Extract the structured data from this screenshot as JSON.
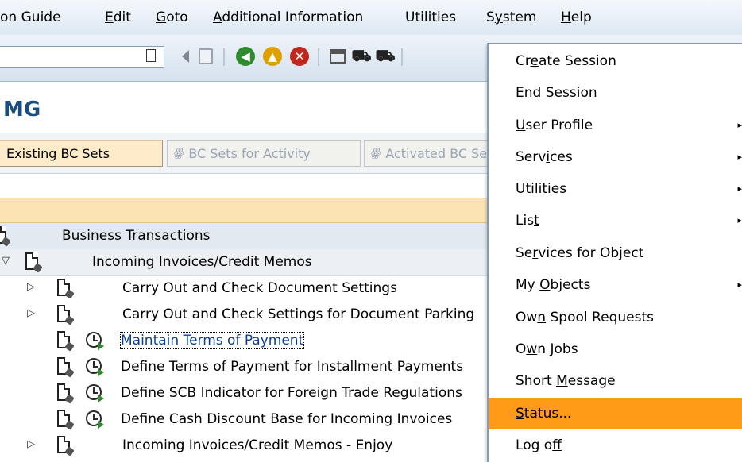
{
  "menubar": {
    "items": [
      {
        "label": "on Guide",
        "u": -1
      },
      {
        "label": "Edit",
        "u": 0
      },
      {
        "label": "Goto",
        "u": 0
      },
      {
        "label": "Additional Information",
        "u": 0
      },
      {
        "label": "Utilities",
        "u": -1
      },
      {
        "label": "System",
        "u": 1
      },
      {
        "label": "Help",
        "u": 0
      }
    ]
  },
  "toolbar": {
    "icons": [
      "dropdown-icon",
      "back-arrow-icon",
      "save-icon",
      "back-icon",
      "exit-icon",
      "cancel-icon",
      "print-icon",
      "find-icon",
      "find-next-icon"
    ]
  },
  "title": "MG",
  "app_toolbar": {
    "buttons": [
      {
        "label": "Existing BC Sets",
        "enabled": true
      },
      {
        "label": "BC Sets for Activity",
        "enabled": false
      },
      {
        "label": "Activated BC Sets for Activity",
        "enabled": false
      }
    ]
  },
  "tree": {
    "rows": [
      {
        "label": "Business Transactions",
        "expander": "",
        "clock": false,
        "selected": false
      },
      {
        "label": "Incoming Invoices/Credit Memos",
        "expander": "▽",
        "clock": false,
        "selected": false
      },
      {
        "label": "Carry Out and Check Document Settings",
        "expander": "▷",
        "clock": false,
        "selected": false
      },
      {
        "label": "Carry Out and Check Settings for Document Parking",
        "expander": "▷",
        "clock": false,
        "selected": false
      },
      {
        "label": "Maintain Terms of Payment",
        "expander": "",
        "clock": true,
        "selected": true
      },
      {
        "label": "Define Terms of Payment for Installment Payments",
        "expander": "",
        "clock": true,
        "selected": false
      },
      {
        "label": "Define SCB Indicator for Foreign Trade Regulations",
        "expander": "",
        "clock": true,
        "selected": false
      },
      {
        "label": "Define Cash Discount Base for Incoming Invoices",
        "expander": "",
        "clock": true,
        "selected": false
      },
      {
        "label": "Incoming Invoices/Credit Memos - Enjoy",
        "expander": "▷",
        "clock": false,
        "selected": false
      }
    ]
  },
  "system_menu": {
    "items": [
      {
        "label": "Create Session",
        "u": 2,
        "submenu": false
      },
      {
        "label": "End Session",
        "u": 2,
        "submenu": false
      },
      {
        "label": "User Profile",
        "u": 0,
        "submenu": true
      },
      {
        "label": "Services",
        "u": 4,
        "submenu": true
      },
      {
        "label": "Utilities",
        "u": -1,
        "submenu": true
      },
      {
        "label": "List",
        "u": 3,
        "submenu": true
      },
      {
        "label": "Services for Object",
        "u": 2,
        "submenu": false
      },
      {
        "label": "My Objects",
        "u": 3,
        "submenu": true
      },
      {
        "label": "Own Spool Requests",
        "u": 2,
        "submenu": false
      },
      {
        "label": "Own Jobs",
        "u": 1,
        "submenu": false
      },
      {
        "label": "Short Message",
        "u": 6,
        "submenu": false
      },
      {
        "label": "Status...",
        "u": 0,
        "submenu": false
      },
      {
        "label": "Log off",
        "u": 5,
        "submenu": false
      }
    ],
    "highlighted": "Status..."
  },
  "colors": {
    "highlight": "#ff9b16",
    "button_bg": "#fdebc9",
    "title": "#1a4d7d"
  }
}
